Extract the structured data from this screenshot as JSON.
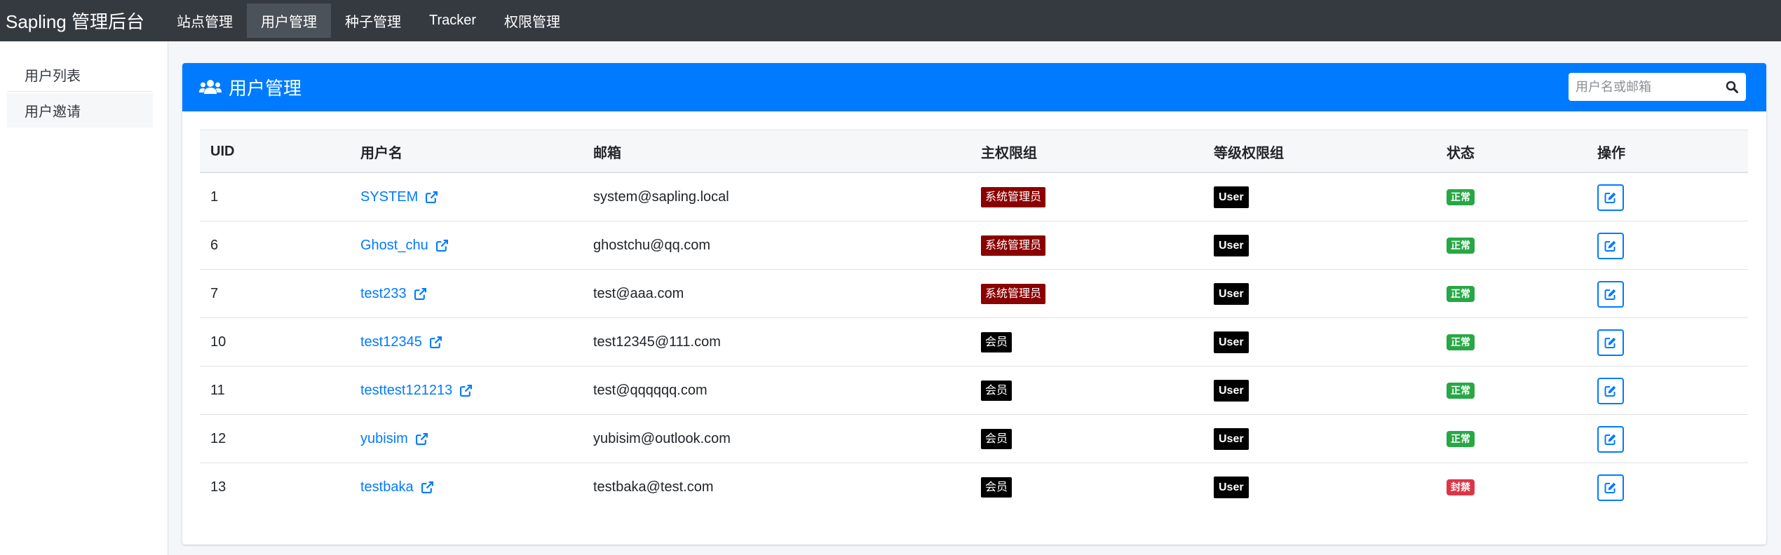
{
  "app": {
    "brand": "Sapling 管理后台"
  },
  "nav": {
    "items": [
      {
        "label": "站点管理",
        "active": false
      },
      {
        "label": "用户管理",
        "active": true
      },
      {
        "label": "种子管理",
        "active": false
      },
      {
        "label": "Tracker",
        "active": false
      },
      {
        "label": "权限管理",
        "active": false
      }
    ]
  },
  "sidebar": {
    "items": [
      {
        "label": "用户列表"
      },
      {
        "label": "用户邀请"
      }
    ]
  },
  "card": {
    "title": "用户管理",
    "icon": "users-icon",
    "search": {
      "placeholder": "用户名或邮箱",
      "value": ""
    }
  },
  "table": {
    "headers": {
      "uid": "UID",
      "username": "用户名",
      "email": "邮箱",
      "main_group": "主权限组",
      "level_group": "等级权限组",
      "status": "状态",
      "actions": "操作"
    },
    "rows": [
      {
        "uid": "1",
        "username": "SYSTEM",
        "email": "system@sapling.local",
        "main_group": "系统管理员",
        "level_group": "User",
        "status": "正常"
      },
      {
        "uid": "6",
        "username": "Ghost_chu",
        "email": "ghostchu@qq.com",
        "main_group": "系统管理员",
        "level_group": "User",
        "status": "正常"
      },
      {
        "uid": "7",
        "username": "test233",
        "email": "test@aaa.com",
        "main_group": "系统管理员",
        "level_group": "User",
        "status": "正常"
      },
      {
        "uid": "10",
        "username": "test12345",
        "email": "test12345@111.com",
        "main_group": "会员",
        "level_group": "User",
        "status": "正常"
      },
      {
        "uid": "11",
        "username": "testtest121213",
        "email": "test@qqqqqq.com",
        "main_group": "会员",
        "level_group": "User",
        "status": "正常"
      },
      {
        "uid": "12",
        "username": "yubisim",
        "email": "yubisim@outlook.com",
        "main_group": "会员",
        "level_group": "User",
        "status": "正常"
      },
      {
        "uid": "13",
        "username": "testbaka",
        "email": "testbaka@test.com",
        "main_group": "会员",
        "level_group": "User",
        "status": "封禁"
      }
    ]
  },
  "colors": {
    "navbar": "#343a40",
    "primary": "#007bff",
    "admin_badge": "#8b0000",
    "member_badge": "#000000",
    "status_ok": "#28a745",
    "status_banned": "#dc3545"
  }
}
